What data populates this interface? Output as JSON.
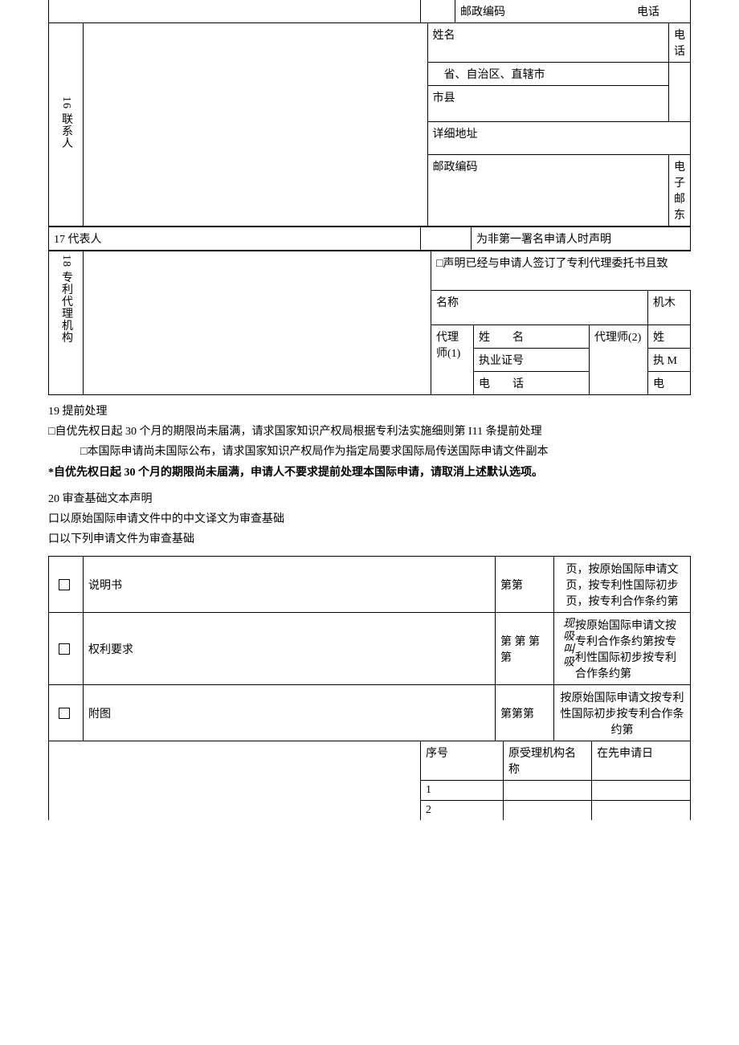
{
  "row0": {
    "postcode": "邮政编码",
    "phone": "电话"
  },
  "s16": {
    "header": "16 联系人",
    "name_label": "姓名",
    "phone_label": "电话",
    "province_label": "省、自治区、直辖市",
    "city_label": "市县",
    "address_label": "详细地址",
    "postcode_label": "邮政编码",
    "email_label": "电子邮东"
  },
  "s17": {
    "header": "17 代表人",
    "declaration": "为非第一署名申请人时声明"
  },
  "s18": {
    "header": "18 专利代理机构",
    "declaration_check": "声明已经与申请人签订了专利代理委托书且致",
    "name_label": "名称",
    "org_label": "机木",
    "agent1": "代理师(1)",
    "agent2": "代理师(2)",
    "name_col": "姓名",
    "license": "执业证号",
    "phone": "电话",
    "name_col2": "姓",
    "license2": "执 M",
    "phone2": "电"
  },
  "s19": {
    "header": "19 提前处理",
    "line1": "□自优先权日起 30 个月的期限尚未届满，请求国家知识产权局根据专利法实施细则第 I11 条提前处理",
    "line2": "□本国际申请尚未国际公布，请求国家知识产权局作为指定局要求国际局传送国际申请文件副本",
    "note": "*自优先权日起 30 个月的期限尚未届满，申请人不要求提前处理本国际申请，请取消上述默认选项。"
  },
  "s20": {
    "header": "20 审查基础文本声明",
    "opt1": "口以原始国际申请文件中的中文译文为审查基础",
    "opt2": "口以下列申请文件为审查基础",
    "spec": "说明书",
    "spec_pages": "第第",
    "spec_desc": "页，按原始国际申请文页，按专利性国际初步页，按专利合作条约第",
    "claim": "权利要求",
    "claim_pages": "第 第 第第",
    "claim_side": "现吸叫吸",
    "claim_desc": "按原始国际申请文按专利合作条约第按专利性国际初步按专利合作条约第",
    "fig": "附图",
    "fig_pages": "第第第",
    "fig_desc": "按原始国际申请文按专利性国际初步按专利合作条约第",
    "seq_header": "序号",
    "org_header": "原受理机构名称",
    "date_header": "在先申请日",
    "seq1": "1",
    "seq2": "2"
  }
}
